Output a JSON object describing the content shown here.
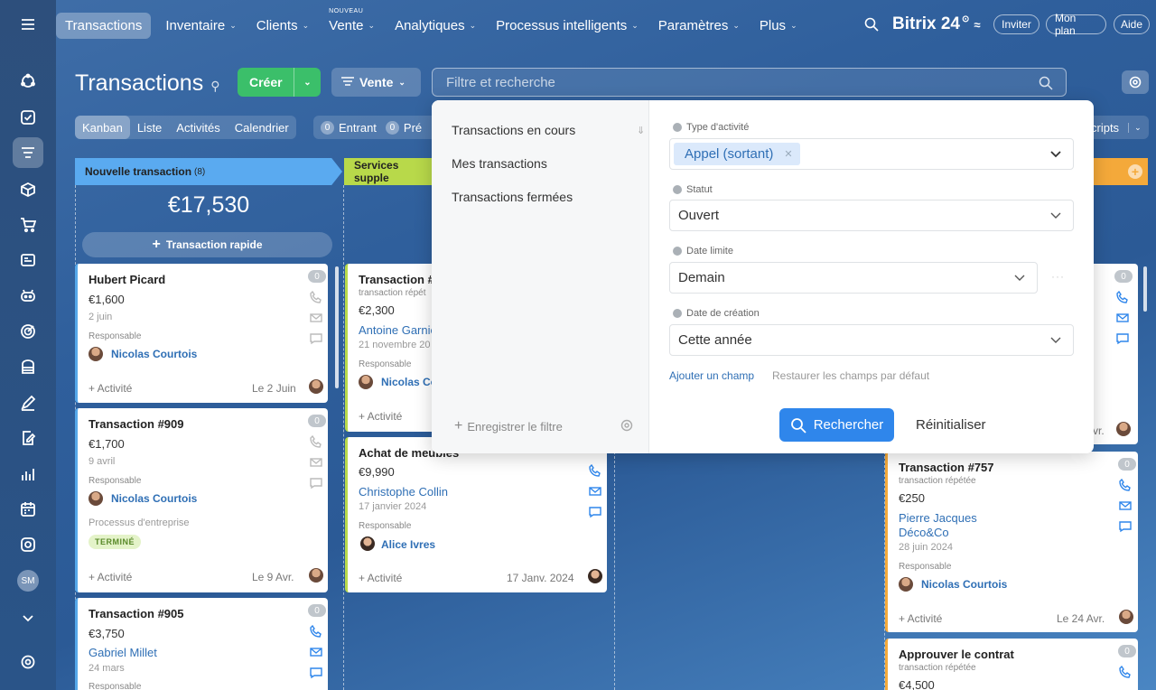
{
  "topnav": {
    "items": [
      {
        "label": "Transactions",
        "new": ""
      },
      {
        "label": "Inventaire",
        "new": ""
      },
      {
        "label": "Clients",
        "new": ""
      },
      {
        "label": "Vente",
        "new": "NOUVEAU"
      },
      {
        "label": "Analytiques",
        "new": ""
      },
      {
        "label": "Processus intelligents",
        "new": ""
      },
      {
        "label": "Paramètres",
        "new": ""
      },
      {
        "label": "Plus",
        "new": ""
      }
    ],
    "brand": "Bitrix 24",
    "invite": "Inviter",
    "plan": "Mon plan",
    "help": "Aide"
  },
  "sidebar": {
    "avatar_initials": "SM"
  },
  "page": {
    "title": "Transactions",
    "create": "Créer",
    "pipeline": "Vente",
    "search_placeholder": "Filtre et recherche"
  },
  "views": [
    "Kanban",
    "Liste",
    "Activités",
    "Calendrier"
  ],
  "counters": [
    {
      "count": "0",
      "label": "Entrant"
    },
    {
      "count": "0",
      "label": "Pré"
    }
  ],
  "scripts_label": "cripts",
  "columns": [
    {
      "title": "Nouvelle transaction",
      "count": "(8)",
      "sum": "€17,530",
      "quick": "Transaction rapide",
      "color": "#5aaaf0"
    },
    {
      "title": "Services supple",
      "color": "#b8d94a"
    }
  ],
  "cards": {
    "c1": {
      "title": "Hubert Picard",
      "amount": "€1,600",
      "date": "2 juin",
      "resp_label": "Responsable",
      "resp": "Nicolas Courtois",
      "activity": "+ Activité",
      "deadline": "Le 2 Juin",
      "badge": "0"
    },
    "c2": {
      "title": "Transaction #909",
      "amount": "€1,700",
      "date": "9 avril",
      "resp_label": "Responsable",
      "resp": "Nicolas Courtois",
      "process": "Processus d'entreprise",
      "status": "TERMINÉ",
      "activity": "+ Activité",
      "deadline": "Le 9 Avr.",
      "badge": "0"
    },
    "c3": {
      "title": "Transaction #905",
      "amount": "€3,750",
      "contact": "Gabriel Millet",
      "date": "24 mars",
      "resp_label": "Responsable",
      "badge": "0"
    },
    "c4": {
      "title": "Transaction #",
      "sub": "transaction répét",
      "amount": "€2,300",
      "contact": "Antoine Garnie",
      "date": "21 novembre 20",
      "resp_label": "Responsable",
      "resp": "Nicolas Co",
      "activity": "+ Activité"
    },
    "c5": {
      "title": "Achat de meubles",
      "amount": "€9,990",
      "contact": "Christophe Collin",
      "date": "17 janvier 2024",
      "resp_label": "Responsable",
      "resp": "Alice Ivres",
      "activity": "+ Activité",
      "deadline": "17 Janv. 2024"
    },
    "c6": {
      "deadline_tail": "vr.",
      "badge": "0"
    },
    "c7": {
      "title": "Transaction #757",
      "sub": "transaction répétée",
      "amount": "€250",
      "contact": "Pierre Jacques",
      "company": "Déco&Co",
      "date": "28 juin 2024",
      "resp_label": "Responsable",
      "resp": "Nicolas Courtois",
      "activity": "+ Activité",
      "deadline": "Le 24 Avr.",
      "badge": "0"
    },
    "c8": {
      "title": "Approuver le contrat",
      "sub": "transaction répétée",
      "amount": "€4,500",
      "badge": "0"
    }
  },
  "filter_panel": {
    "presets": [
      "Transactions en cours",
      "Mes transactions",
      "Transactions fermées"
    ],
    "save_filter": "Enregistrer le filtre",
    "fields": [
      {
        "label": "Type d'activité",
        "value": "Appel (sortant)"
      },
      {
        "label": "Statut",
        "value": "Ouvert"
      },
      {
        "label": "Date limite",
        "value": "Demain"
      },
      {
        "label": "Date de création",
        "value": "Cette année"
      }
    ],
    "add_field": "Ajouter un champ",
    "restore_fields": "Restaurer les champs par défaut",
    "search_button": "Rechercher",
    "reset_button": "Réinitialiser"
  }
}
